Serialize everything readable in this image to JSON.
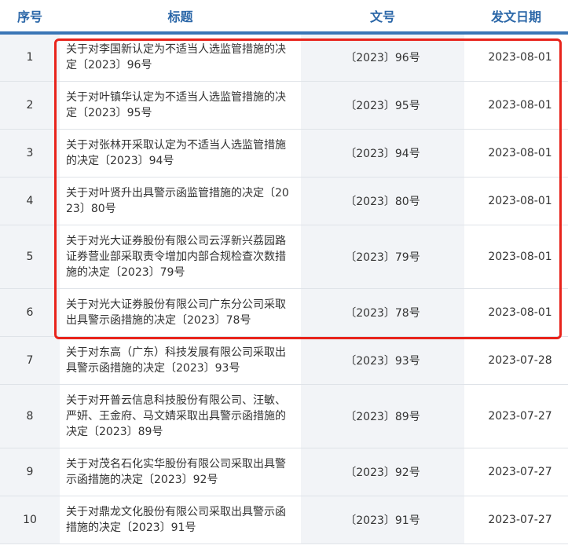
{
  "header": {
    "no": "序号",
    "title": "标题",
    "doc_no": "文号",
    "date": "发文日期"
  },
  "rows": [
    {
      "no": "1",
      "title": "关于对李国新认定为不适当人选监管措施的决定〔2023〕96号",
      "doc_no": "〔2023〕96号",
      "date": "2023-08-01"
    },
    {
      "no": "2",
      "title": "关于对叶镇华认定为不适当人选监管措施的决定〔2023〕95号",
      "doc_no": "〔2023〕95号",
      "date": "2023-08-01"
    },
    {
      "no": "3",
      "title": "关于对张林开采取认定为不适当人选监管措施的决定〔2023〕94号",
      "doc_no": "〔2023〕94号",
      "date": "2023-08-01"
    },
    {
      "no": "4",
      "title": "关于对叶贤升出具警示函监管措施的决定〔2023〕80号",
      "doc_no": "〔2023〕80号",
      "date": "2023-08-01"
    },
    {
      "no": "5",
      "title": "关于对光大证券股份有限公司云浮新兴荔园路证券营业部采取责令增加内部合规检查次数措施的决定〔2023〕79号",
      "doc_no": "〔2023〕79号",
      "date": "2023-08-01"
    },
    {
      "no": "6",
      "title": "关于对光大证券股份有限公司广东分公司采取出具警示函措施的决定〔2023〕78号",
      "doc_no": "〔2023〕78号",
      "date": "2023-08-01"
    },
    {
      "no": "7",
      "title": "关于对东高（广东）科技发展有限公司采取出具警示函措施的决定〔2023〕93号",
      "doc_no": "〔2023〕93号",
      "date": "2023-07-28"
    },
    {
      "no": "8",
      "title": "关于对开普云信息科技股份有限公司、汪敏、严妍、王金府、马文婧采取出具警示函措施的决定〔2023〕89号",
      "doc_no": "〔2023〕89号",
      "date": "2023-07-27"
    },
    {
      "no": "9",
      "title": "关于对茂名石化实华股份有限公司采取出具警示函措施的决定〔2023〕92号",
      "doc_no": "〔2023〕92号",
      "date": "2023-07-27"
    },
    {
      "no": "10",
      "title": "关于对鼎龙文化股份有限公司采取出具警示函措施的决定〔2023〕91号",
      "doc_no": "〔2023〕91号",
      "date": "2023-07-27"
    }
  ],
  "highlight": {
    "color": "#e8231b",
    "rows": [
      1,
      2,
      3,
      4,
      5,
      6
    ]
  }
}
